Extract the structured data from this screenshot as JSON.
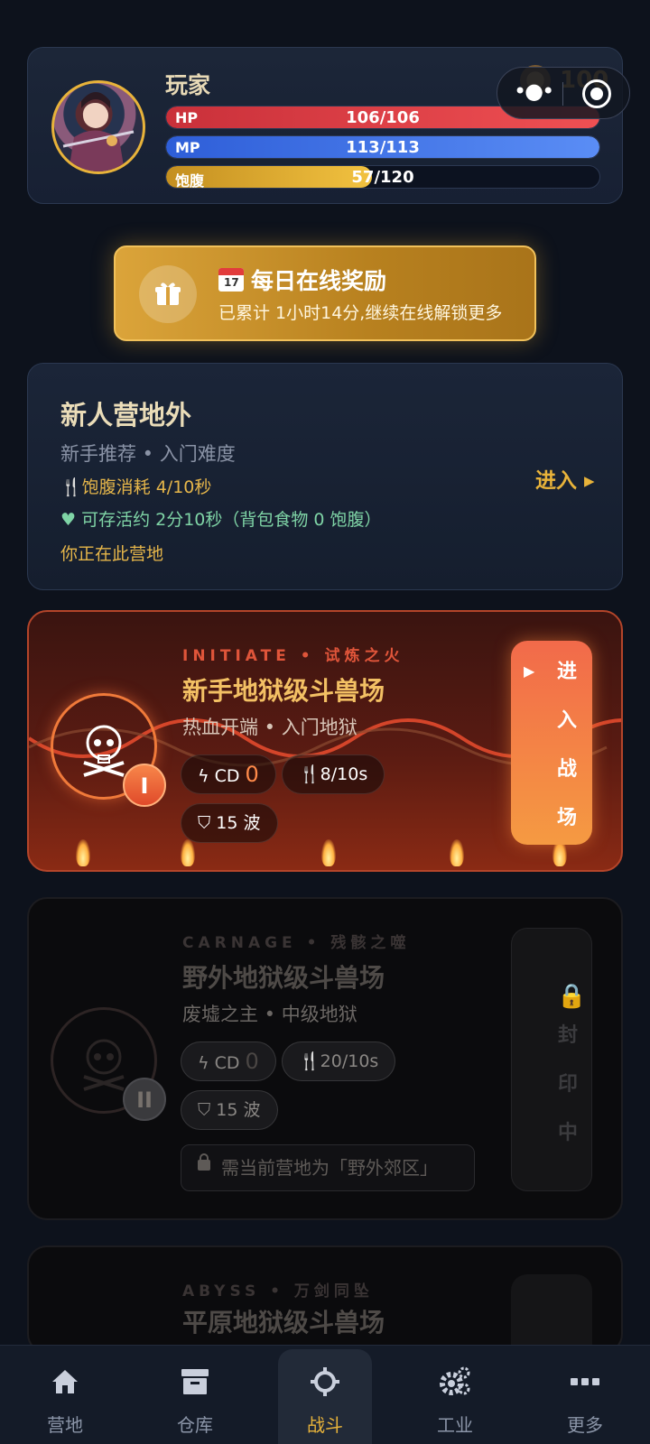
{
  "player": {
    "name": "玩家",
    "coins": "100",
    "hp": {
      "label": "HP",
      "value": "106/106",
      "fraction": 1.0
    },
    "mp": {
      "label": "MP",
      "value": "113/113",
      "fraction": 1.0
    },
    "food": {
      "label": "饱腹",
      "value": "57/120",
      "fraction": 0.475
    }
  },
  "reward": {
    "title": "每日在线奖励",
    "subtitle": "已累计 1小时14分,继续在线解锁更多"
  },
  "camp": {
    "title": "新人营地外",
    "subtitle": "新手推荐 • 入门难度",
    "food_cost": "饱腹消耗 4/10秒",
    "survival": "可存活约 2分10秒（背包食物 0 饱腹）",
    "here": "你正在此营地",
    "enter": "进入 ▸"
  },
  "arenas": [
    {
      "tag": "INITIATE • 试炼之火",
      "title": "新手地狱级斗兽场",
      "subtitle": "热血开端 • 入门地狱",
      "badge": "I",
      "cd_label": "CD",
      "cd_value": "0",
      "food_rate": "8/10s",
      "waves": "15 波",
      "button": [
        "进",
        "入",
        "战",
        "场"
      ],
      "locked": false
    },
    {
      "tag": "CARNAGE • 残骸之噬",
      "title": "野外地狱级斗兽场",
      "subtitle": "废墟之主 • 中级地狱",
      "badge": "II",
      "cd_label": "CD",
      "cd_value": "0",
      "food_rate": "20/10s",
      "waves": "15 波",
      "button": [
        "封",
        "印",
        "中"
      ],
      "lock_note": "需当前营地为「野外郊区」",
      "locked": true
    },
    {
      "tag": "ABYSS • 万剑同坠",
      "title": "平原地狱级斗兽场",
      "locked": true
    }
  ],
  "nav": [
    {
      "label": "营地",
      "icon": "home-icon"
    },
    {
      "label": "仓库",
      "icon": "archive-icon"
    },
    {
      "label": "战斗",
      "icon": "crosshair-icon",
      "active": true
    },
    {
      "label": "工业",
      "icon": "gears-icon"
    },
    {
      "label": "更多",
      "icon": "more-icon"
    }
  ],
  "colors": {
    "accent_gold": "#e8b33a",
    "hp": "#e8444a",
    "mp": "#4a7ce8",
    "food": "#e6b23a",
    "life_green": "#7fd4a6"
  }
}
